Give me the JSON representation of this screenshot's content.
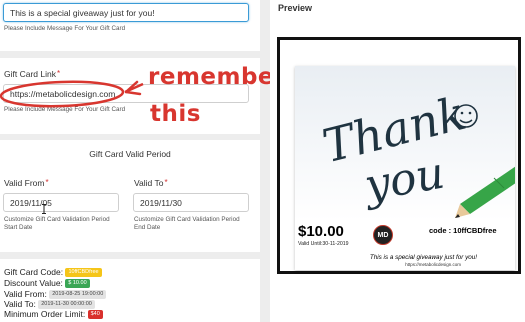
{
  "message": {
    "value": "This is a special giveaway just for you!",
    "help": "Please Include Message For Your Gift Card"
  },
  "link": {
    "label": "Gift Card Link",
    "required": "*",
    "value": "https://metabolicdesign.com",
    "help": "Please Include Message For Your Gift Card"
  },
  "annotation": {
    "line1": "remember",
    "line2": "this"
  },
  "period": {
    "title": "Gift Card Valid Period",
    "from_label": "Valid From",
    "from_value": "2019/11/05",
    "from_help_1": "Customize Gift Card Validation Period",
    "from_help_2": "Start Date",
    "to_label": "Valid To",
    "to_value": "2019/11/30",
    "to_help_1": "Customize Gift Card Validation Period",
    "to_help_2": "End Date",
    "required": "*"
  },
  "summary": {
    "code_label": "Gift Card Code:",
    "code_value": "10ffCBDfree",
    "discount_label": "Discount Value:",
    "discount_value": "$ 10.00",
    "from_label": "Valid From:",
    "from_value": "2019-08-25 19:00:00",
    "to_label": "Valid To:",
    "to_value": "2019-11-30 00:00:00",
    "min_label": "Minimum Order Limit:",
    "min_value": "$40"
  },
  "preview": {
    "title": "Preview",
    "art_line1": "Thank",
    "art_line2": "you",
    "price": "$10.00",
    "valid_until": "Valid Until:30-11-2019",
    "logo": "MD",
    "code": "code : 10ffCBDfree",
    "message": "This is a special giveaway just for you!",
    "url": "https://metabolicdesign.com"
  },
  "colors": {
    "accent": "#3b9bd6",
    "annotation": "#d8362f",
    "badge_yellow": "#f5c518",
    "badge_green": "#3aa655",
    "badge_red": "#d9302c"
  }
}
